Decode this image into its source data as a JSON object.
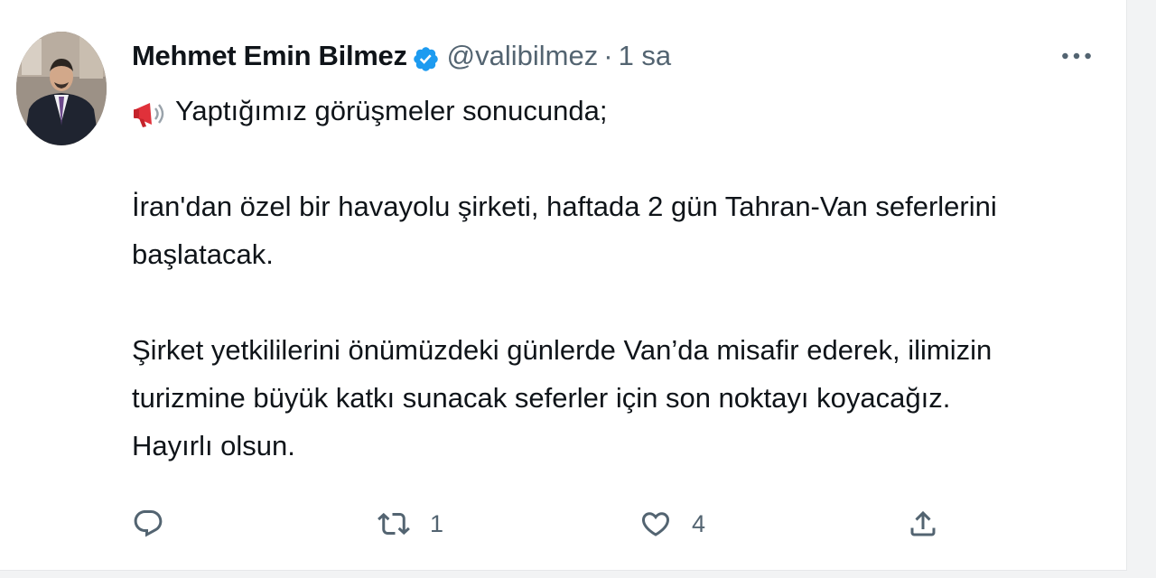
{
  "tweet": {
    "author_name": "Mehmet Emin Bilmez",
    "handle": "@valibilmez",
    "separator": "·",
    "time": "1 sa",
    "lines": {
      "l1": "Yaptığımız görüşmeler sonucunda;",
      "l2": "İran'dan özel bir havayolu şirketi, haftada 2 gün Tahran-Van seferlerini",
      "l3": "başlatacak.",
      "l4": "Şirket yetkililerini önümüzdeki günlerde Van’da misafir ederek, ilimizin",
      "l5": "turizmine büyük katkı sunacak seferler için son noktayı koyacağız.",
      "l6": "Hayırlı olsun."
    },
    "stats": {
      "replies": "",
      "retweets": "1",
      "likes": "4"
    }
  },
  "icons": {
    "verified": "verified-badge-icon",
    "megaphone": "megaphone-emoji",
    "more": "more-horizontal-icon",
    "reply": "reply-icon",
    "retweet": "retweet-icon",
    "like": "heart-icon",
    "share": "share-icon"
  },
  "colors": {
    "verified_blue": "#1d9bf0",
    "text_primary": "#0f1419",
    "text_secondary": "#536471",
    "megaphone_red": "#e0313a"
  }
}
